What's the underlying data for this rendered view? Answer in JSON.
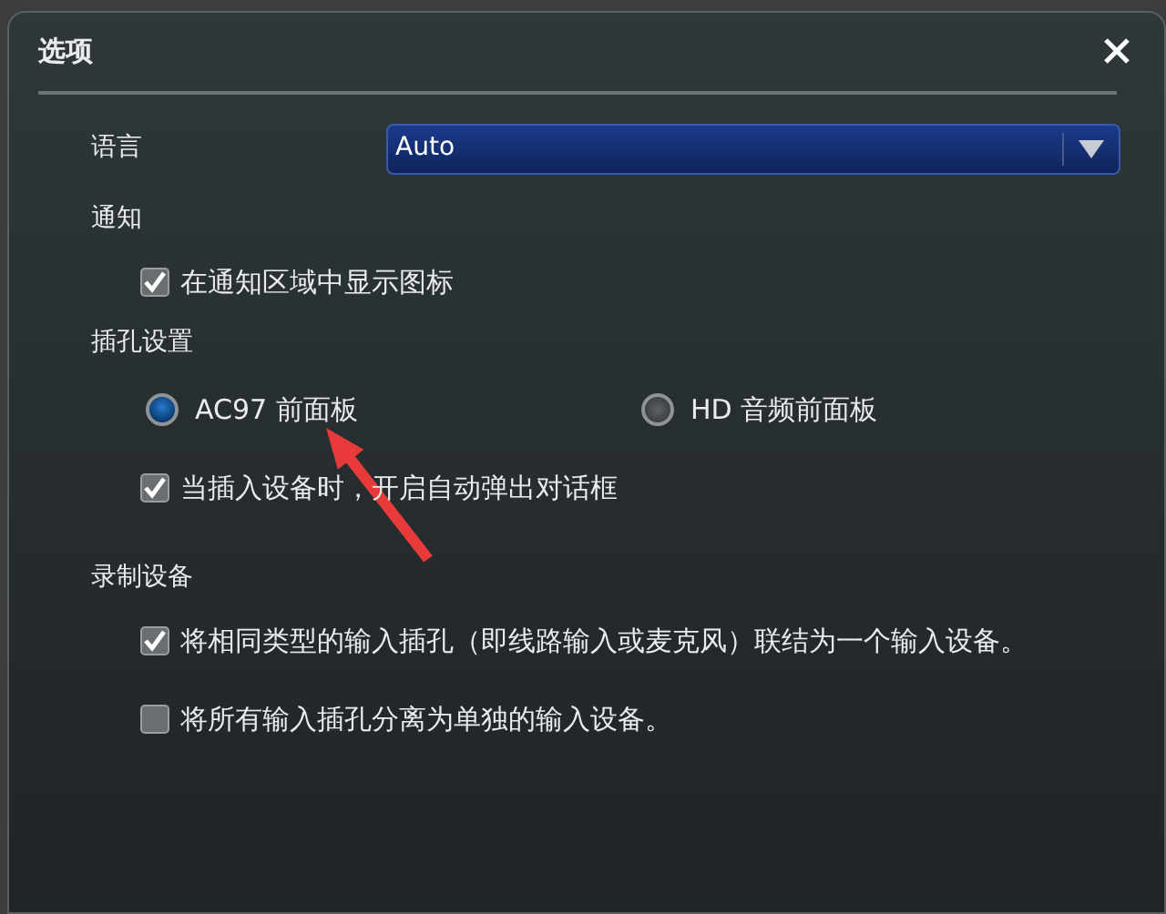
{
  "window": {
    "title": "选项"
  },
  "language": {
    "label": "语言",
    "value": "Auto"
  },
  "sections": [
    {
      "title": "通知",
      "items": [
        {
          "kind": "checkbox",
          "label": "在通知区域中显示图标",
          "checked": true
        }
      ]
    },
    {
      "title": "插孔设置",
      "items": [
        {
          "kind": "radios",
          "options": [
            {
              "label": "AC97 前面板",
              "selected": true
            },
            {
              "label": "HD 音频前面板",
              "selected": false
            }
          ]
        },
        {
          "kind": "checkbox",
          "label": "当插入设备时，开启自动弹出对话框",
          "checked": true
        }
      ]
    },
    {
      "title": "录制设备",
      "items": [
        {
          "kind": "checkbox",
          "label": "将相同类型的输入插孔（即线路输入或麦克风）联结为一个输入设备。",
          "checked": true
        },
        {
          "kind": "checkbox",
          "label": "将所有输入插孔分离为单独的输入设备。",
          "checked": false
        }
      ]
    }
  ]
}
